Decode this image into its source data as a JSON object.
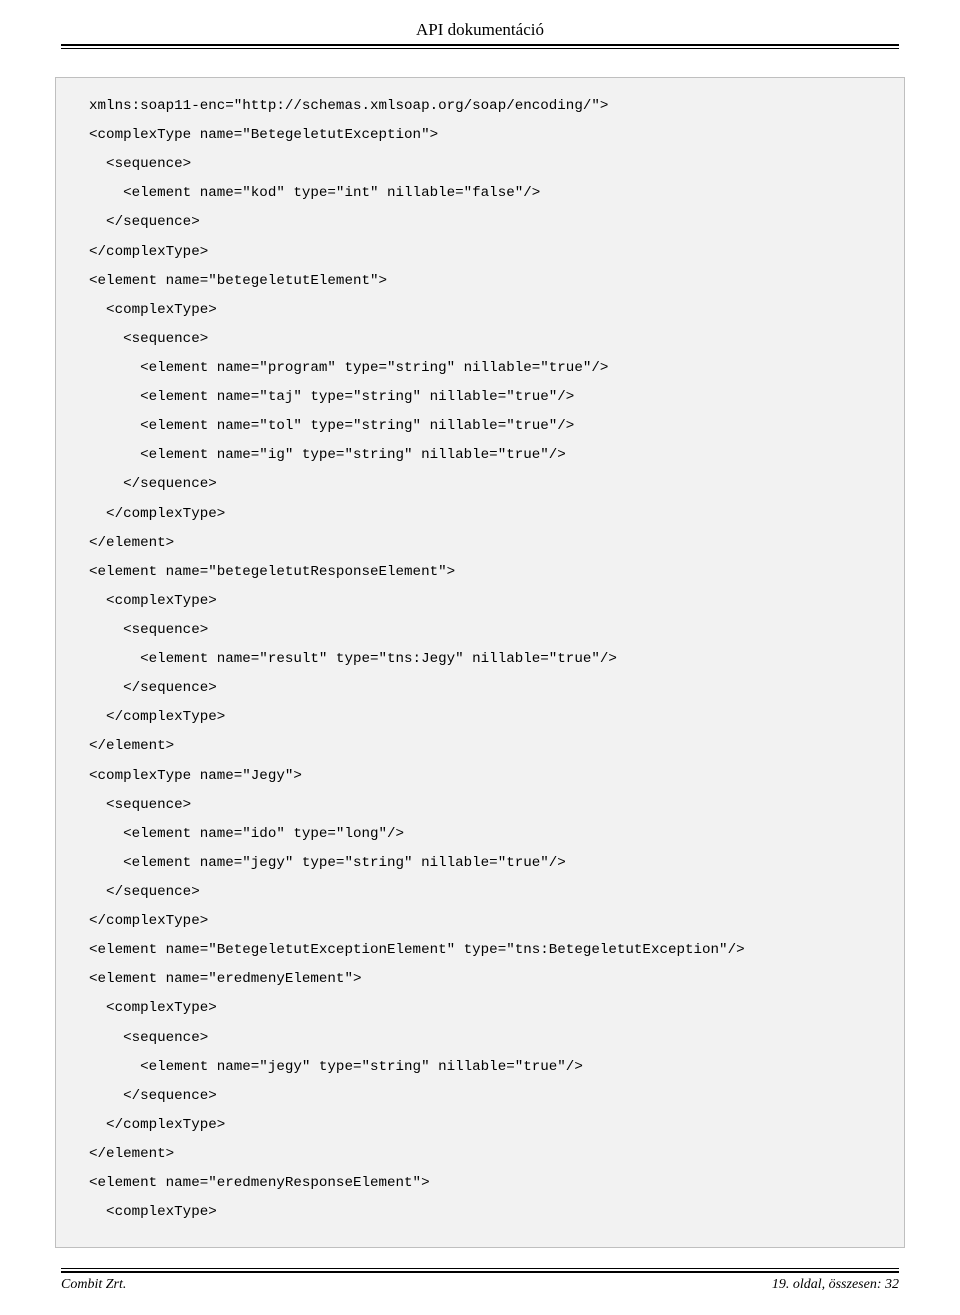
{
  "header": {
    "title": "API dokumentáció"
  },
  "code": {
    "lines": [
      "  xmlns:soap11-enc=\"http://schemas.xmlsoap.org/soap/encoding/\">",
      "  <complexType name=\"BetegeletutException\">",
      "    <sequence>",
      "      <element name=\"kod\" type=\"int\" nillable=\"false\"/>",
      "    </sequence>",
      "  </complexType>",
      "  <element name=\"betegeletutElement\">",
      "    <complexType>",
      "      <sequence>",
      "        <element name=\"program\" type=\"string\" nillable=\"true\"/>",
      "        <element name=\"taj\" type=\"string\" nillable=\"true\"/>",
      "        <element name=\"tol\" type=\"string\" nillable=\"true\"/>",
      "        <element name=\"ig\" type=\"string\" nillable=\"true\"/>",
      "      </sequence>",
      "    </complexType>",
      "  </element>",
      "  <element name=\"betegeletutResponseElement\">",
      "    <complexType>",
      "      <sequence>",
      "        <element name=\"result\" type=\"tns:Jegy\" nillable=\"true\"/>",
      "      </sequence>",
      "    </complexType>",
      "  </element>",
      "  <complexType name=\"Jegy\">",
      "    <sequence>",
      "      <element name=\"ido\" type=\"long\"/>",
      "      <element name=\"jegy\" type=\"string\" nillable=\"true\"/>",
      "    </sequence>",
      "  </complexType>",
      "  <element name=\"BetegeletutExceptionElement\" type=\"tns:BetegeletutException\"/>",
      "  <element name=\"eredmenyElement\">",
      "    <complexType>",
      "      <sequence>",
      "        <element name=\"jegy\" type=\"string\" nillable=\"true\"/>",
      "      </sequence>",
      "    </complexType>",
      "  </element>",
      "  <element name=\"eredmenyResponseElement\">",
      "    <complexType>"
    ]
  },
  "footer": {
    "left": "Combit Zrt.",
    "right": "19. oldal, összesen: 32"
  }
}
